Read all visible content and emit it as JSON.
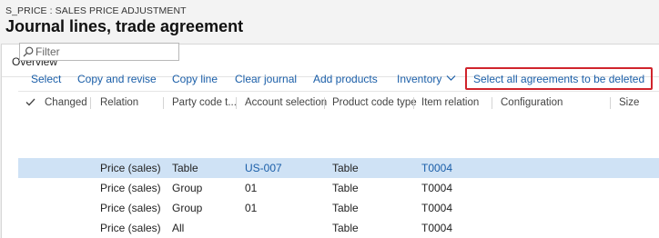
{
  "breadcrumb": "S_PRICE : SALES PRICE ADJUSTMENT",
  "page_title": "Journal lines, trade agreement",
  "section": {
    "title": "Overview"
  },
  "filter": {
    "placeholder": "Filter",
    "value": ""
  },
  "toolbar": {
    "select": "Select",
    "copy_and_revise": "Copy and revise",
    "copy_line": "Copy line",
    "clear_journal": "Clear journal",
    "add_products": "Add products",
    "inventory": "Inventory",
    "select_all_agreements": "Select all agreements to be deleted"
  },
  "highlight_color": "#d0242c",
  "link_color": "#1a5ea8",
  "selected_row_color": "#cfe2f5",
  "columns": {
    "changed": "Changed",
    "relation": "Relation",
    "party_code_type": "Party code t...",
    "account_selection": "Account selection",
    "product_code_type": "Product code type",
    "item_relation": "Item relation",
    "configuration": "Configuration",
    "size": "Size"
  },
  "rows": [
    {
      "relation": "Price (sales)",
      "party_code_type": "Table",
      "account_selection": "US-007",
      "product_code_type": "Table",
      "item_relation": "T0004"
    },
    {
      "relation": "Price (sales)",
      "party_code_type": "Group",
      "account_selection": "01",
      "product_code_type": "Table",
      "item_relation": "T0004"
    },
    {
      "relation": "Price (sales)",
      "party_code_type": "Group",
      "account_selection": "01",
      "product_code_type": "Table",
      "item_relation": "T0004"
    },
    {
      "relation": "Price (sales)",
      "party_code_type": "All",
      "account_selection": "",
      "product_code_type": "Table",
      "item_relation": "T0004"
    }
  ]
}
